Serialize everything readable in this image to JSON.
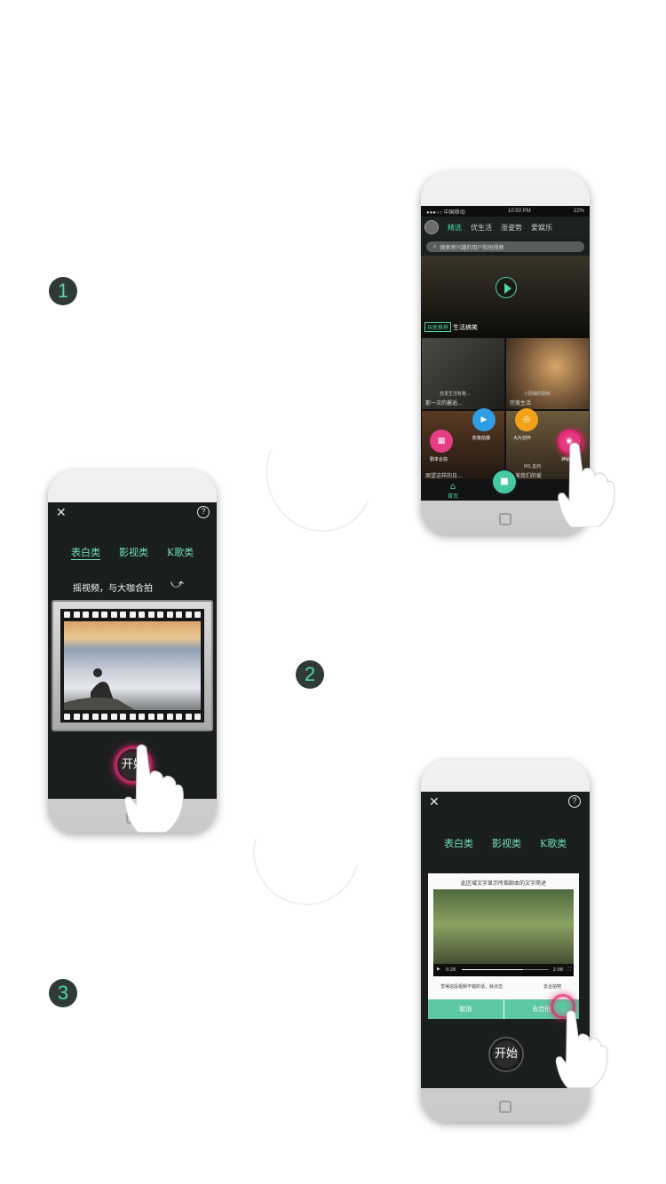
{
  "steps": [
    "1",
    "2",
    "3"
  ],
  "phone1": {
    "status": {
      "carrier": "●●●○○ 中国移动",
      "time": "10:50 PM",
      "battery": "22%"
    },
    "tabs": [
      "精选",
      "优生活",
      "涨姿势",
      "爱娱乐"
    ],
    "active_tab": "精选",
    "search_placeholder": "搜索感兴趣的用户和短视频",
    "hero": {
      "tag": "玩家推荐",
      "caption": "生活搞笑"
    },
    "cells": [
      {
        "user": "自发生活有格...",
        "caption": "那一次的邂逅..."
      },
      {
        "user": "小厨娘的厨房",
        "caption": "完美生活"
      },
      {
        "user": "",
        "caption": "周望这样的日..."
      },
      {
        "user": "MS.善药",
        "caption": "最美我们的爱"
      }
    ],
    "fabs": [
      {
        "label": "剧本合拍",
        "color": "#e53e86"
      },
      {
        "label": "影像拍摄",
        "color": "#2f9de4"
      },
      {
        "label": "大片创作",
        "color": "#f2a219"
      },
      {
        "label": "神秘",
        "color": "#e53e86"
      }
    ],
    "bottom_home": "首页"
  },
  "phone2": {
    "categories": [
      "表白类",
      "影视类",
      "K歌类"
    ],
    "active_category": "表白类",
    "hint": "摇视频，与大咖合拍",
    "start": "开始"
  },
  "phone3": {
    "categories": [
      "表白类",
      "影视类",
      "K歌类"
    ],
    "dialog_title": "此区域文字显示所摇剧本的文字简述",
    "time_elapsed": "0:28",
    "time_total": "2:08",
    "dialog_hint": "觉得这段视频不错的话，就点击",
    "dialog_hint_tail": "去合拍吧",
    "cancel": "取消",
    "confirm": "去合拍",
    "start": "开始"
  }
}
